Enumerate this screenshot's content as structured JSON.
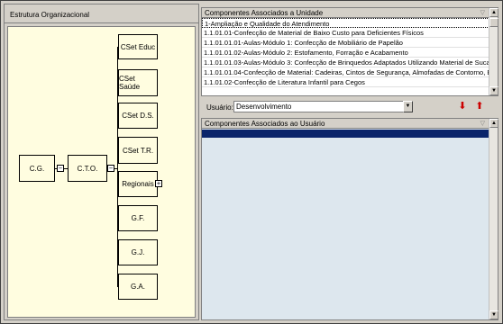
{
  "org": {
    "title": "Estrutura Organizacional",
    "nodes": {
      "cg": "C.G.",
      "cto": "C.T.O.",
      "cset_educ": "CSet Educ",
      "cset_saude": "CSet Saúde",
      "cset_ds": "CSet D.S.",
      "cset_tr": "CSet T.R.",
      "regionais": "Regionais",
      "gf": "G.F.",
      "gj": "G.J.",
      "ga": "G.A."
    },
    "collapse_symbol": "−",
    "expand_symbol": "+"
  },
  "unit_components": {
    "title": "Componentes Associados a Unidade",
    "rows": [
      "1-Ampliação e Qualidade do Atendimento",
      "1.1.01.01-Confecção de Material de Baixo Custo para Deficientes Físicos",
      "1.1.01.01.01-Aulas-Módulo 1: Confecção de Mobiliário de Papelão",
      "1.1.01.01.02-Aulas-Módulo 2: Estofamento, Forração e Acabamento",
      "1.1.01.01.03-Aulas-Módulo 3: Confecção de Brinquedos Adaptados Utilizando Material de Sucata",
      "1.1.01.01.04-Confecção de Material: Cadeiras, Cintos de Segurança, Almofadas de Contorno, Etc.",
      "1.1.01.02-Confecção de Literatura Infantil para Cegos"
    ]
  },
  "user_filter": {
    "label": "Usuário:",
    "value": "Desenvolvimento",
    "down_symbol": "⬇",
    "up_symbol": "⬆"
  },
  "user_components": {
    "title": "Componentes Associados ao Usuário"
  },
  "icons": {
    "filter": "funnel-icon",
    "scroll_up": "▲",
    "scroll_down": "▼",
    "combo_arrow": "▼"
  },
  "colors": {
    "canvas_bg": "#fffde0",
    "selection": "#0a246a",
    "list_bg": "#dde7ee",
    "arrow": "#cc0000"
  }
}
